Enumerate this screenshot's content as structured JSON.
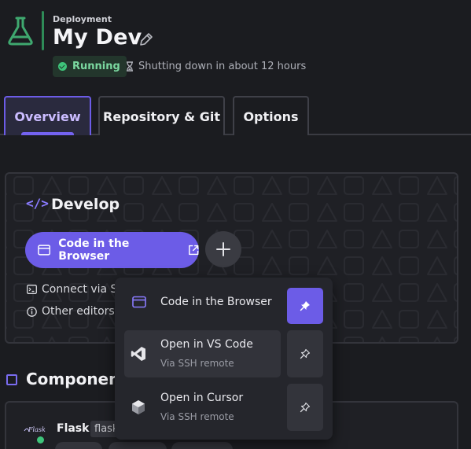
{
  "header": {
    "eyebrow": "Deployment",
    "title": "My Dev",
    "status": "Running",
    "shutdown_text": "Shutting down in about 12 hours"
  },
  "tabs": [
    {
      "label": "Overview",
      "active": true
    },
    {
      "label": "Repository & Git",
      "active": false
    },
    {
      "label": "Options",
      "active": false
    }
  ],
  "develop": {
    "title": "Develop",
    "primary_button": "Code in the Browser",
    "connect_ssh": "Connect via S",
    "other_editors": "Other editors"
  },
  "dropdown": {
    "items": [
      {
        "label": "Code in the Browser",
        "sub": "",
        "pinned": true
      },
      {
        "label": "Open in VS Code",
        "sub": "Via SSH remote",
        "pinned": false
      },
      {
        "label": "Open in Cursor",
        "sub": "Via SSH remote",
        "pinned": false
      }
    ]
  },
  "components": {
    "title": "Component",
    "item_name": "Flask",
    "item_chip": "flask",
    "logo_text": "Flask"
  },
  "colors": {
    "accent": "#6c5ce7",
    "running": "#3ec47a",
    "background": "#1b1c20"
  }
}
